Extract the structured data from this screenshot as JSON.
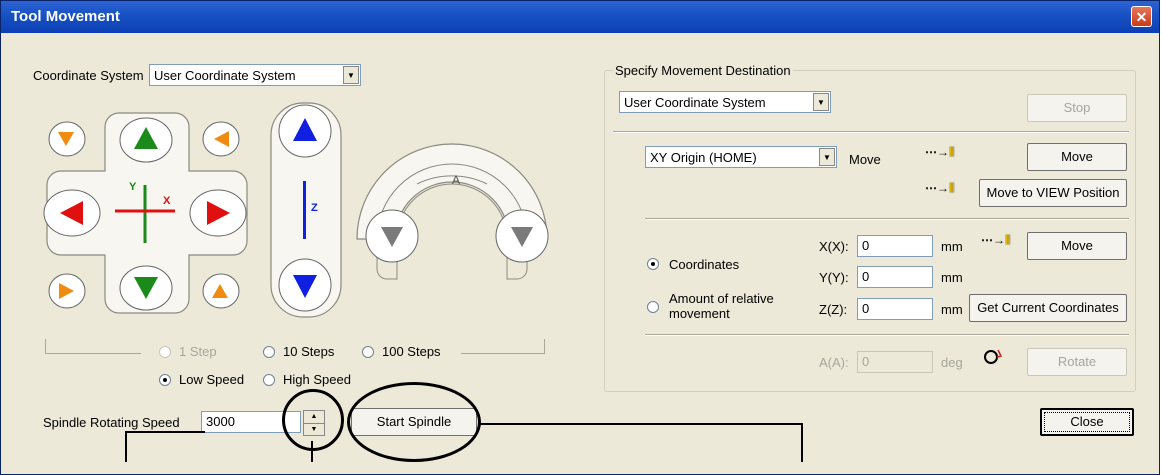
{
  "window": {
    "title": "Tool Movement",
    "close_glyph": "✕"
  },
  "left": {
    "coordinate_system_label": "Coordinate System",
    "coordinate_system_value": "User Coordinate System",
    "axis_x": "X",
    "axis_y": "Y",
    "axis_z": "Z",
    "axis_a": "A",
    "steps": [
      "1 Step",
      "10 Steps",
      "100 Steps"
    ],
    "speeds": [
      "Low Speed",
      "High Speed"
    ],
    "spindle_label": "Spindle Rotating Speed",
    "spindle_value": "3000",
    "start_spindle": "Start Spindle"
  },
  "right": {
    "group_title": "Specify Movement Destination",
    "dest_coord_value": "User Coordinate System",
    "stop": "Stop",
    "origin_value": "XY Origin (HOME)",
    "move_label": "Move",
    "move": "Move",
    "move_to_view": "Move to VIEW Position",
    "radio_coordinates": "Coordinates",
    "radio_relative": "Amount of relative movement",
    "x_label": "X(X):",
    "y_label": "Y(Y):",
    "z_label": "Z(Z):",
    "a_label": "A(A):",
    "x_value": "0",
    "y_value": "0",
    "z_value": "0",
    "a_value": "0",
    "unit_mm": "mm",
    "unit_deg": "deg",
    "move2": "Move",
    "get_current": "Get Current Coordinates",
    "rotate": "Rotate",
    "close": "Close"
  },
  "colors": {
    "green": "#1a8a1a",
    "red": "#e01010",
    "blue": "#1020e0",
    "orange": "#f08a10"
  }
}
